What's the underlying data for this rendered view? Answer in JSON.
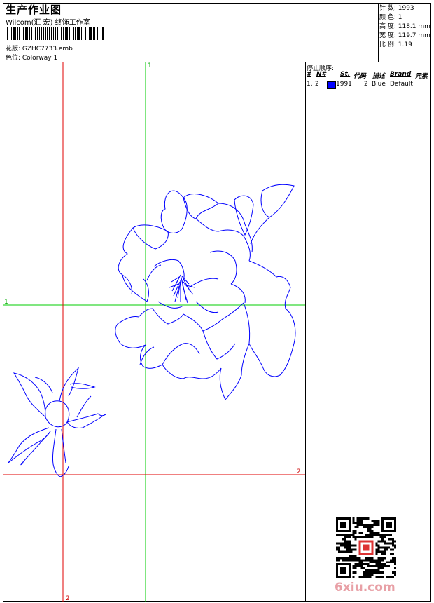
{
  "header": {
    "title": "生产作业图",
    "company": "Wilcom(汇 宏) 终饰工作室",
    "pattern": "花版:  GZHC7733.emb",
    "colorway": "色位:  Colorway 1"
  },
  "stats": [
    "针  数:  1993",
    "颜  色:  1",
    "高  度:  118.1 mm",
    "宽  度:  119.7 mm",
    "比  例:  1.19"
  ],
  "stop_sequence": {
    "title": "停止顺序:",
    "columns": [
      "#",
      "N#",
      "St.",
      "代码",
      "描述",
      "Brand",
      "元素"
    ],
    "rows": [
      {
        "index": "1.",
        "needle": "2",
        "stitches": "1991",
        "code": "2",
        "description": "Blue",
        "brand": "Default",
        "color": "#0000ff"
      }
    ]
  },
  "guides": {
    "green_top": "1",
    "green_left": "1",
    "red_right": "2",
    "red_bottom": "2"
  },
  "colors": {
    "thread": "#0000ff",
    "guide_green": "#00cc00",
    "guide_red": "#e00000"
  },
  "watermark": "6xiu.com"
}
